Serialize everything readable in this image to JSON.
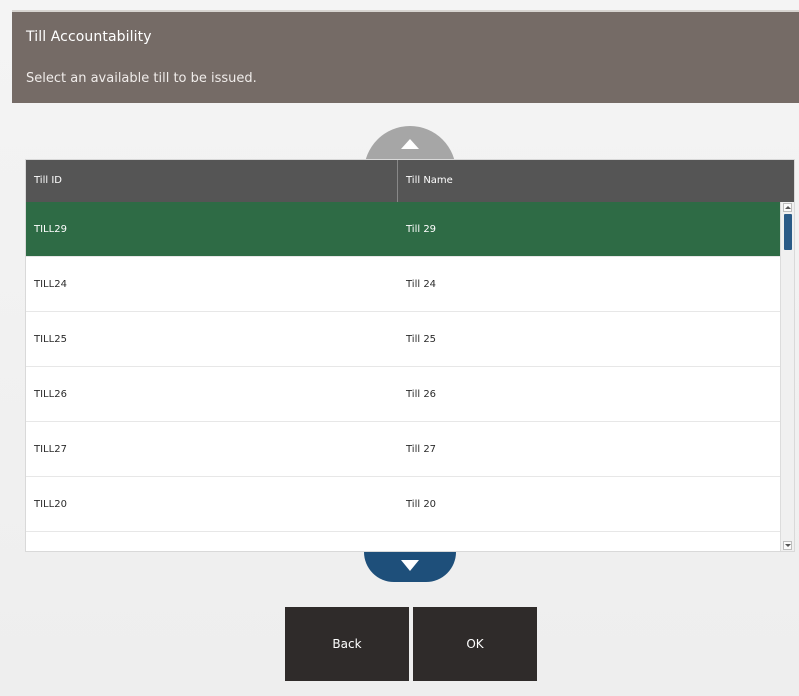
{
  "header": {
    "title": "Till Accountability",
    "subtitle": "Select an available till to be issued."
  },
  "table": {
    "columns": [
      "Till ID",
      "Till Name"
    ],
    "rows": [
      {
        "id": "TILL29",
        "name": "Till 29",
        "selected": true
      },
      {
        "id": "TILL24",
        "name": "Till 24",
        "selected": false
      },
      {
        "id": "TILL25",
        "name": "Till 25",
        "selected": false
      },
      {
        "id": "TILL26",
        "name": "Till 26",
        "selected": false
      },
      {
        "id": "TILL27",
        "name": "Till 27",
        "selected": false
      },
      {
        "id": "TILL20",
        "name": "Till 20",
        "selected": false
      }
    ]
  },
  "buttons": {
    "back_label": "Back",
    "ok_label": "OK"
  },
  "colors": {
    "header_bg": "#756b66",
    "selected_row": "#2e6b45",
    "table_header": "#555555",
    "scroll_up": "#a6a6a6",
    "scroll_down": "#1e4f7a",
    "button_bg": "#2f2b2a"
  },
  "icons": {
    "scroll_up": "chevron-up-icon",
    "scroll_down": "chevron-down-icon"
  }
}
